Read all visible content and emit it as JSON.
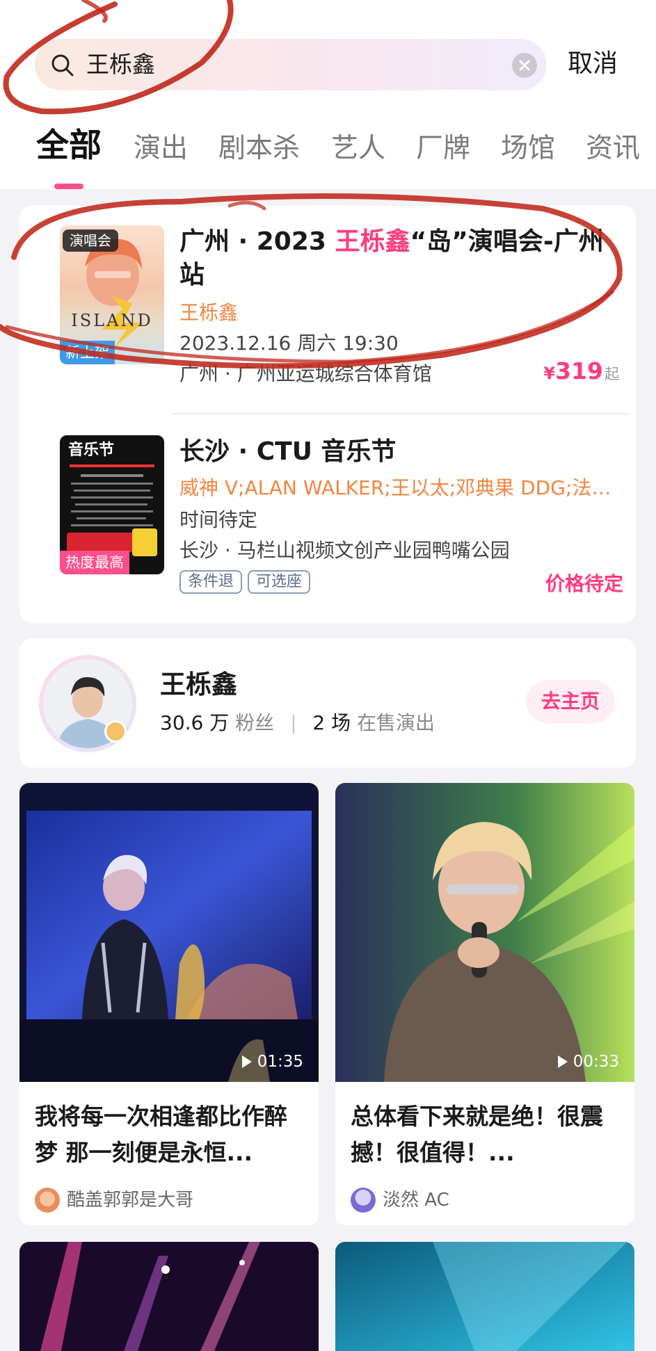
{
  "search": {
    "query": "王栎鑫",
    "cancel_label": "取消"
  },
  "tabs": [
    {
      "label": "全部",
      "active": true
    },
    {
      "label": "演出",
      "active": false
    },
    {
      "label": "剧本杀",
      "active": false
    },
    {
      "label": "艺人",
      "active": false
    },
    {
      "label": "厂牌",
      "active": false
    },
    {
      "label": "场馆",
      "active": false
    },
    {
      "label": "资讯",
      "active": false
    }
  ],
  "events": [
    {
      "poster_tag": "演唱会",
      "poster_badge": "新上架",
      "title_prefix": "广州 · 2023 ",
      "title_highlight": "王栎鑫",
      "title_suffix": "“岛”演唱会-广州站",
      "artists": "王栎鑫",
      "datetime": "2023.12.16 周六 19:30",
      "venue": "广州 · 广州亚运城综合体育馆",
      "price_symbol": "¥",
      "price": "319",
      "price_suffix": "起"
    },
    {
      "poster_tag": "音乐节",
      "poster_badge": "热度最高",
      "title": "长沙 · CTU 音乐节",
      "artists": "威神 V;ALAN WALKER;王以太;邓典果 DDG;法老...",
      "datetime": "时间待定",
      "venue": "长沙 · 马栏山视频文创产业园鸭嘴公园",
      "chips": [
        "条件退",
        "可选座"
      ],
      "price_text": "价格待定"
    }
  ],
  "artist": {
    "name": "王栎鑫",
    "fans_count": "30.6 万",
    "fans_label": "粉丝",
    "shows_count": "2 场",
    "shows_label": "在售演出",
    "home_button": "去主页"
  },
  "videos": [
    {
      "duration": "01:35",
      "title": "我将每一次相逢都比作醉梦 那一刻便是永恒...",
      "user": "酷盖郭郭是大哥"
    },
    {
      "duration": "00:33",
      "title": "总体看下来就是绝！很震撼！很值得！...",
      "user": "淡然 AC"
    }
  ],
  "colors": {
    "accent": "#ff3b7f",
    "artist_orange": "#f2853f",
    "scribble": "#c0281b"
  }
}
